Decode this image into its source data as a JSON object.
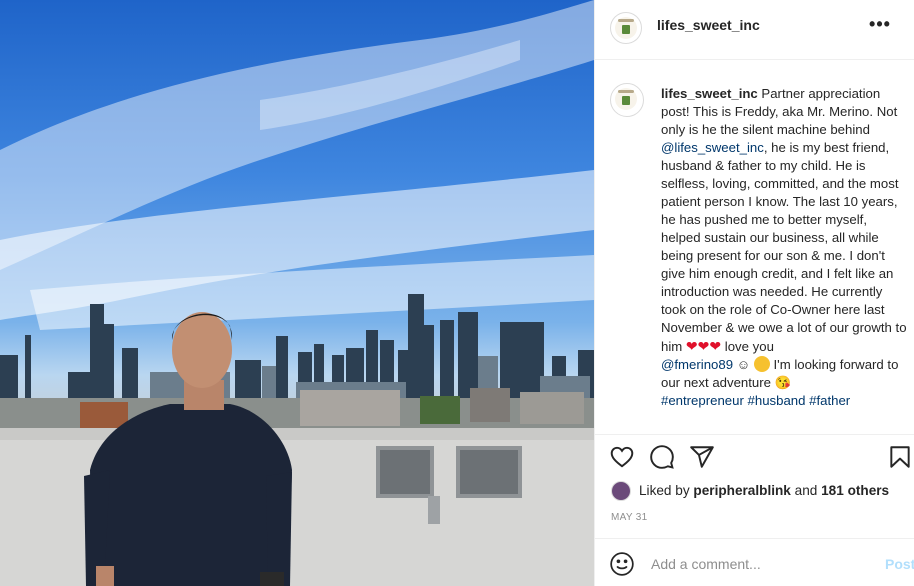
{
  "post": {
    "image_alt": "Man in navy polo shirt standing on a rooftop with a city skyline behind him",
    "account": "lifes_sweet_inc",
    "more_label": "•••",
    "caption": {
      "username": "lifes_sweet_inc",
      "text_1": " Partner appreciation post! This is Freddy, aka Mr. Merino. Not only is he the silent machine behind ",
      "mention_1": "@lifes_sweet_inc",
      "text_2": ", he is my best friend, husband & father to my child. He is selfless, loving, committed, and the most patient person I know. The last 10 years, he has pushed me to better myself, helped sustain our business, all while being present for our son & me. I don't give him enough credit, and I felt like an introduction was needed. He currently took on the role of Co-Owner here last November & we owe a lot of our growth to him ",
      "hearts": "❤❤❤",
      "text_3": " love you ",
      "mention_2": "@fmerino89",
      "text_4": " ☺",
      "text_5": " I'm looking forward to our next adventure ",
      "wink": "😘",
      "hashtags": [
        "#entrepreneur",
        "#husband",
        "#father"
      ]
    },
    "likes": {
      "prefix": "Liked by ",
      "user": "peripheralblink",
      "middle": " and ",
      "others": "181 others"
    },
    "date": "MAY 31",
    "comment": {
      "placeholder": "Add a comment...",
      "post_label": "Post"
    },
    "icons": [
      "heart-icon",
      "comment-icon",
      "share-icon",
      "bookmark-icon",
      "smiley-icon",
      "more-icon"
    ],
    "colors": {
      "link": "#00376b",
      "post_disabled": "#b2dffc",
      "muted": "#8e8e8e"
    }
  }
}
